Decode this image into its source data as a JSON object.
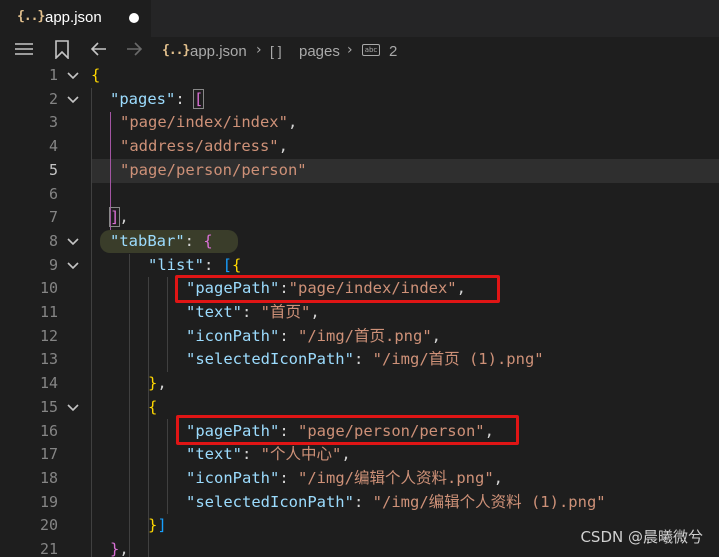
{
  "tab": {
    "icon_text": "{..}",
    "label": "app.json",
    "unsaved": true
  },
  "breadcrumb": {
    "file_icon_text": "{..}",
    "file": "app.json",
    "array_icon_text": "[ ]",
    "key": "pages",
    "string_icon_text": "abc",
    "index": "2"
  },
  "editor": {
    "active_line": "5",
    "lines": [
      {
        "n": "1"
      },
      {
        "n": "2"
      },
      {
        "n": "3"
      },
      {
        "n": "4"
      },
      {
        "n": "5"
      },
      {
        "n": "6"
      },
      {
        "n": "7"
      },
      {
        "n": "8"
      },
      {
        "n": "9"
      },
      {
        "n": "10"
      },
      {
        "n": "11"
      },
      {
        "n": "12"
      },
      {
        "n": "13"
      },
      {
        "n": "14"
      },
      {
        "n": "15"
      },
      {
        "n": "16"
      },
      {
        "n": "17"
      },
      {
        "n": "18"
      },
      {
        "n": "19"
      },
      {
        "n": "20"
      },
      {
        "n": "21"
      }
    ],
    "tokens": {
      "l1_brace": "{",
      "l2_key": "\"pages\"",
      "l2_colon": ": ",
      "l2_bracket": "[",
      "l3_value": "\"page/index/index\"",
      "l3_comma": ",",
      "l4_value": "\"address/address\"",
      "l4_comma": ",",
      "l5_value": "\"page/person/person\"",
      "l7_bracket": "]",
      "l7_comma": ",",
      "l8_key": "\"tabBar\"",
      "l8_colon": ": ",
      "l8_brace": "{",
      "l9_key": "\"list\"",
      "l9_colon": ": ",
      "l9_bracket": "[",
      "l9_brace": "{",
      "l10_key": "\"pagePath\"",
      "l10_colon": ":",
      "l10_value": "\"page/index/index\"",
      "l10_comma": ",",
      "l11_key": "\"text\"",
      "l11_colon": ": ",
      "l11_value": "\"首页\"",
      "l11_comma": ",",
      "l12_key": "\"iconPath\"",
      "l12_colon": ": ",
      "l12_value": "\"/img/首页.png\"",
      "l12_comma": ",",
      "l13_key": "\"selectedIconPath\"",
      "l13_colon": ": ",
      "l13_value": "\"/img/首页 (1).png\"",
      "l14_brace": "}",
      "l14_comma": ",",
      "l15_brace": "{",
      "l16_key": "\"pagePath\"",
      "l16_colon": ": ",
      "l16_value": "\"page/person/person\"",
      "l16_comma": ",",
      "l17_key": "\"text\"",
      "l17_colon": ": ",
      "l17_value": "\"个人中心\"",
      "l17_comma": ",",
      "l18_key": "\"iconPath\"",
      "l18_colon": ": ",
      "l18_value": "\"/img/编辑个人资料.png\"",
      "l18_comma": ",",
      "l19_key": "\"selectedIconPath\"",
      "l19_colon": ": ",
      "l19_value": "\"/img/编辑个人资料 (1).png\"",
      "l20_brace": "}",
      "l20_bracket": "]",
      "l21_brace": "}",
      "l21_comma": ","
    }
  },
  "watermark": "CSDN @晨曦微兮",
  "colors": {
    "key": "#9cdcfe",
    "string": "#ce9178",
    "bracket_level1": "#ffd700",
    "bracket_level2": "#da70d6",
    "bracket_level3": "#179fff",
    "annotation_box": "#e01515"
  }
}
